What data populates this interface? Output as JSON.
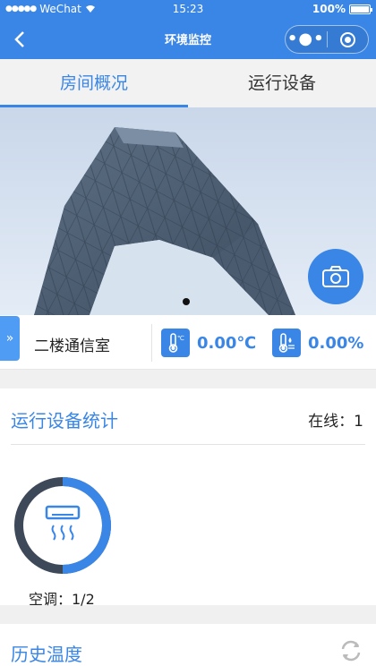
{
  "status_bar": {
    "carrier": "WeChat",
    "time": "15:23",
    "battery": "100%"
  },
  "nav": {
    "title": "环境监控"
  },
  "tabs": [
    {
      "label": "房间概况",
      "active": true
    },
    {
      "label": "运行设备",
      "active": false
    }
  ],
  "room": {
    "name": "二楼通信室",
    "temperature": "0.00℃",
    "humidity": "0.00%"
  },
  "device_stats": {
    "title": "运行设备统计",
    "online": "在线：1",
    "items": [
      {
        "name": "空调：1/2",
        "online_fraction": 0.5,
        "icon": "air-conditioner-icon"
      }
    ]
  },
  "history": {
    "title": "历史温度"
  },
  "colors": {
    "primary": "#3a86e6",
    "gauge_track": "#3d4858"
  },
  "icons": [
    "back-arrow-icon",
    "more-icon",
    "target-icon",
    "camera-icon",
    "thermometer-icon",
    "humidity-icon",
    "air-conditioner-icon",
    "refresh-icon"
  ]
}
